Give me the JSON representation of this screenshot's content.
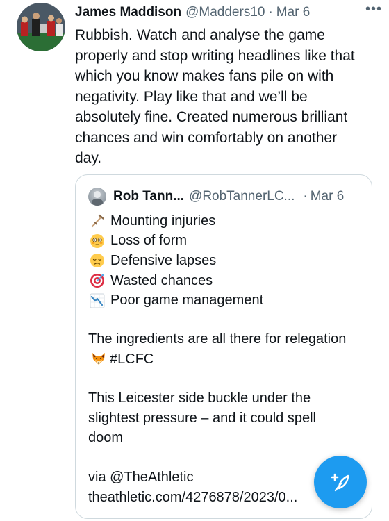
{
  "tweet": {
    "author_name": "James Maddison",
    "author_handle": "@Madders10",
    "separator": "·",
    "date": "Mar 6",
    "more": "•••",
    "text": "Rubbish. Watch and analyse the game properly and stop writing headlines like that which you know makes fans pile on with negativity. Play like that and we’ll be absolutely fine. Created numerous brilliant chances and win comfortably on another day."
  },
  "quote": {
    "author_name": "Rob Tann...",
    "author_handle": "@RobTannerLC...",
    "separator": "·",
    "date": "Mar 6",
    "lines": [
      {
        "icon": "crutch-icon",
        "text": "Mounting injuries"
      },
      {
        "icon": "flushed-face-icon",
        "text": "Loss of form"
      },
      {
        "icon": "disappointed-face-icon",
        "text": "Defensive lapses"
      },
      {
        "icon": "target-icon",
        "text": "Wasted chances"
      },
      {
        "icon": "chart-decreasing-icon",
        "text": "Poor game management"
      }
    ],
    "para1_before": "The ingredients are all there for relegation",
    "para1_hashtag": "#LCFC",
    "para1_icon": "fox-icon",
    "para2": "This Leicester side buckle under the slightest pressure – and it could spell doom",
    "via": "via @TheAthletic",
    "link": "theathletic.com/4276878/2023/0..."
  },
  "fab": {
    "icon": "compose-feather-icon",
    "color": "#1d9bf0"
  }
}
